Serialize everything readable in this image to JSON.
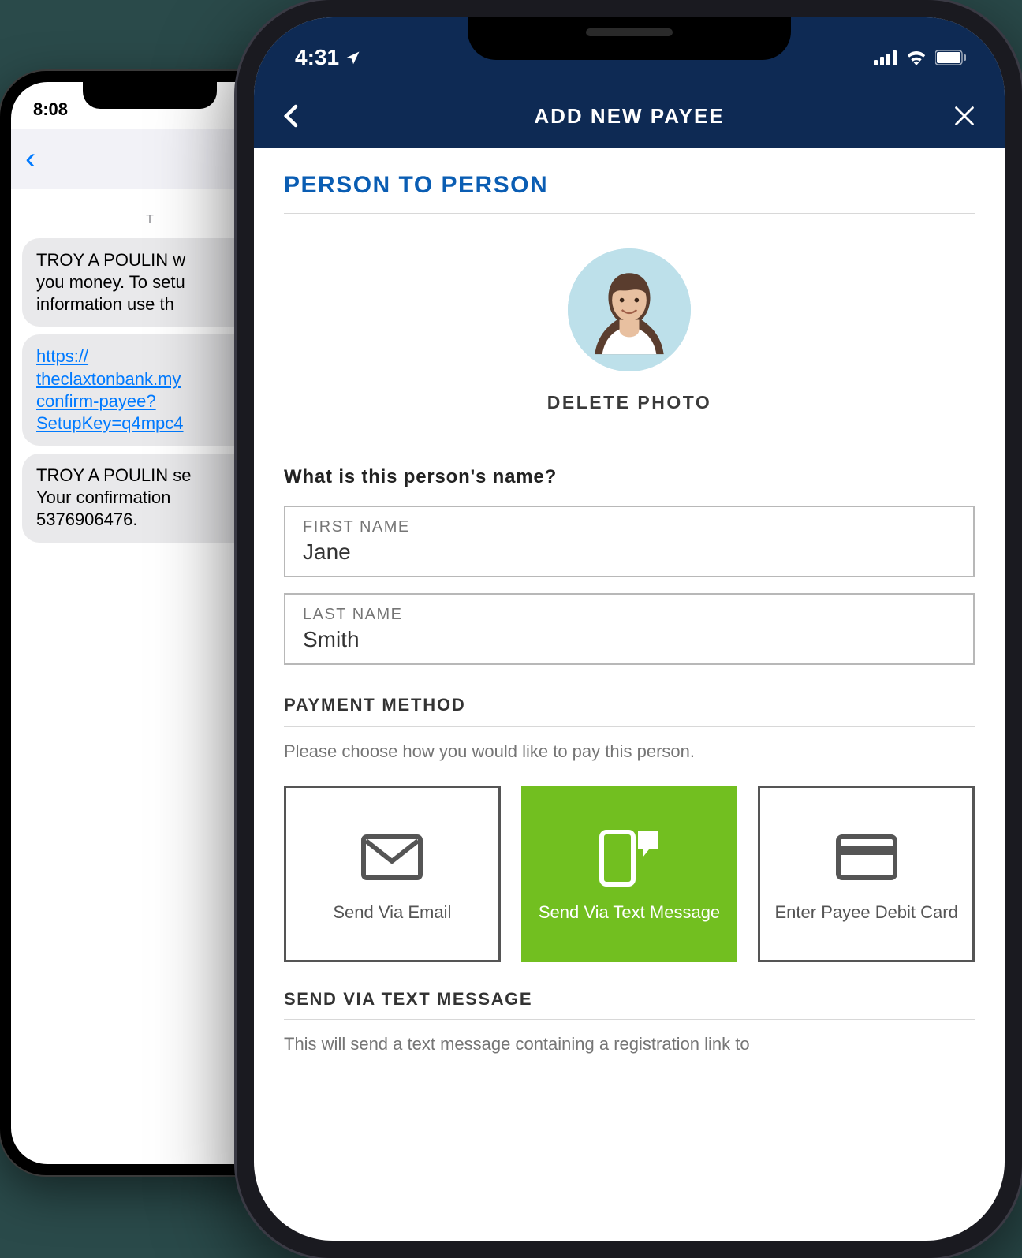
{
  "back_phone": {
    "status_time": "8:08",
    "messages": {
      "bubble1": "TROY A POULIN w\nyou money. To setu\ninformation use th",
      "bubble2_link": "https://\ntheclaxtonbank.my\nconfirm-payee?\nSetupKey=q4mpc4",
      "bubble3": "TROY A POULIN se\nYour confirmation\n5376906476."
    }
  },
  "front_phone": {
    "status_time": "4:31",
    "header": {
      "title": "ADD NEW PAYEE"
    },
    "section_title": "PERSON TO PERSON",
    "delete_photo": "DELETE PHOTO",
    "name_question": "What is this person's name?",
    "first_name_label": "FIRST NAME",
    "first_name_value": "Jane",
    "last_name_label": "LAST NAME",
    "last_name_value": "Smith",
    "payment_heading": "PAYMENT METHOD",
    "payment_desc": "Please choose how you would like to pay this person.",
    "methods": {
      "email": "Send Via Email",
      "text": "Send Via Text Message",
      "debit": "Enter Payee Debit Card"
    },
    "send_title": "SEND VIA TEXT MESSAGE",
    "send_desc": "This will send a text message containing a registration link to"
  }
}
